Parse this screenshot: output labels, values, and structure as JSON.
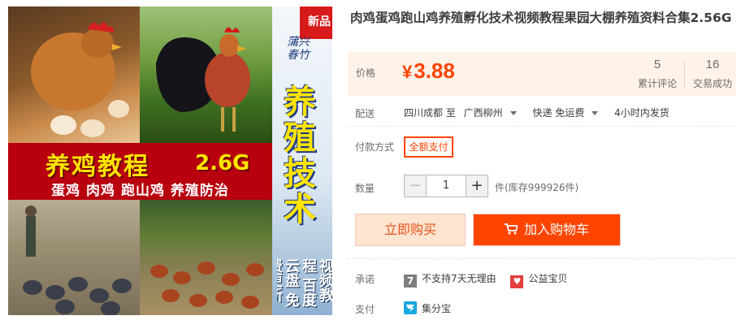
{
  "gallery": {
    "new_badge": "新品",
    "calligraphy": "蒲兴春竹",
    "banner_title": "养鸡教程",
    "banner_size": "2.6G",
    "banner_subtitle": "蛋鸡 肉鸡 跑山鸡 养殖防治",
    "vertical_title": "养殖技术",
    "vertical_footer": "视频教程 百度云盘 免费更新"
  },
  "product": {
    "title": "肉鸡蛋鸡跑山鸡养殖孵化技术视频教程果园大棚养殖资料合集2.56G"
  },
  "price": {
    "label": "价格",
    "currency": "¥",
    "value": "3.88",
    "reviews_count": "5",
    "reviews_label": "累计评论",
    "trades_count": "16",
    "trades_label": "交易成功"
  },
  "shipping": {
    "label": "配送",
    "from": "四川成都 至",
    "to": "广西柳州",
    "method": "快递 免运费",
    "dispatch": "4小时内发货"
  },
  "payment": {
    "label": "付款方式",
    "option": "全额支付"
  },
  "quantity": {
    "label": "数量",
    "minus": "−",
    "value": "1",
    "plus": "+",
    "stock": "件(库存999926件)"
  },
  "actions": {
    "buy_now": "立即购买",
    "add_to_cart": "加入购物车"
  },
  "promise": {
    "label": "承诺",
    "icon_7_text": "7",
    "no_return": "不支持7天无理由",
    "charity": "公益宝贝"
  },
  "pay_method": {
    "label": "支付",
    "jifenbao": "集分宝"
  },
  "colors": {
    "accent": "#ff4400",
    "price_bg": "#fff2e8",
    "buy_now_bg": "#ffe4d0"
  }
}
